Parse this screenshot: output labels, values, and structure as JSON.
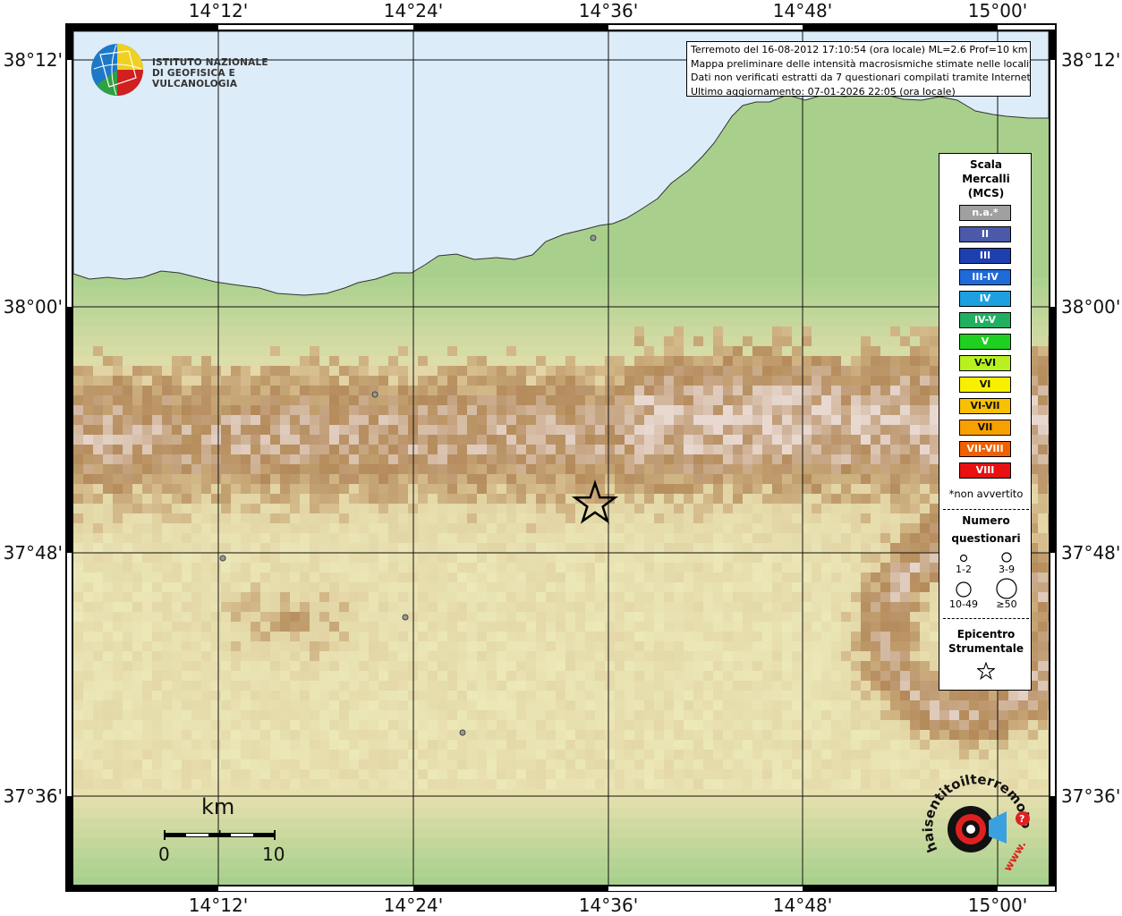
{
  "map": {
    "longitude_ticks": [
      "14°12'",
      "14°24'",
      "14°36'",
      "14°48'",
      "15°00'"
    ],
    "latitude_ticks": [
      "38°12'",
      "38°00'",
      "37°48'",
      "37°36'"
    ],
    "colors": {
      "sea": "#dcecf8",
      "land_low": "#e8e0b0",
      "land_green": "#a8d08c",
      "land_mid": "#d8c090",
      "land_high": "#b48a5a",
      "peak": "#e8d8d0"
    }
  },
  "info": {
    "line1": "Terremoto del 16-08-2012 17:10:54 (ora locale) ML=2.6 Prof=10 km",
    "line2": "Mappa preliminare delle intensità macrosismiche stimate nelle località",
    "line3": "Dati non verificati estratti da 7 questionari compilati tramite Internet.",
    "line4": "Ultimo aggiornamento: 07-01-2026 22:05 (ora locale)"
  },
  "logo": {
    "line1": "ISTITUTO NAZIONALE",
    "line2": "DI GEOFISICA E VULCANOLOGIA"
  },
  "legend": {
    "title1": "Scala",
    "title2": "Mercalli",
    "title3": "(MCS)",
    "intensities": [
      {
        "label": "n.a.*",
        "color": "#a0a0a0"
      },
      {
        "label": "II",
        "color": "#4a5aa8"
      },
      {
        "label": "III",
        "color": "#1e3fb0"
      },
      {
        "label": "III-IV",
        "color": "#1e6ad8"
      },
      {
        "label": "IV",
        "color": "#1ea0e0"
      },
      {
        "label": "IV-V",
        "color": "#20b060"
      },
      {
        "label": "V",
        "color": "#20d020"
      },
      {
        "label": "V-VI",
        "color": "#b8f020"
      },
      {
        "label": "VI",
        "color": "#f8f000"
      },
      {
        "label": "VI-VII",
        "color": "#f8c000"
      },
      {
        "label": "VII",
        "color": "#f8a000"
      },
      {
        "label": "VII-VIII",
        "color": "#f06000"
      },
      {
        "label": "VIII",
        "color": "#e81010"
      }
    ],
    "footnote": "*non avvertito",
    "questionnaire_title1": "Numero",
    "questionnaire_title2": "questionari",
    "q_labels": [
      "1-2",
      "3-9",
      "10-49",
      "≥50"
    ],
    "epicenter_title1": "Epicentro",
    "epicenter_title2": "Strumentale"
  },
  "scale": {
    "unit": "km",
    "start": "0",
    "end": "10"
  },
  "hst_logo": {
    "text": "haisentitoilterremoto.it",
    "www": "www."
  }
}
